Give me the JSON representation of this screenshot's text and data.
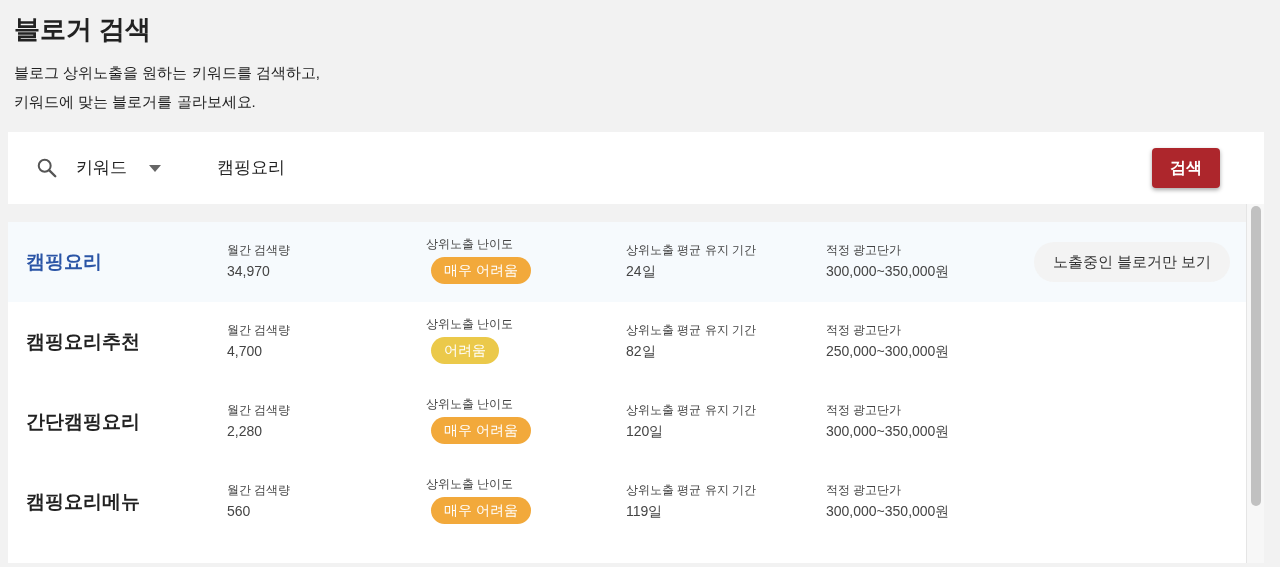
{
  "header": {
    "title": "블로거 검색",
    "description_lines": [
      "블로그 상위노출을 원하는 키워드를 검색하고,",
      "키워드에 맞는 블로거를 골라보세요."
    ]
  },
  "search": {
    "mode": "키워드",
    "value": "캠핑요리",
    "button": "검색"
  },
  "results": [
    {
      "keyword": "캠핑요리",
      "selected": true,
      "volume_label": "월간 검색량",
      "volume": "34,970",
      "difficulty_label": "상위노출 난이도",
      "difficulty": "매우 어려움",
      "color": "#f2a93b",
      "duration_label": "상위노출 평균 유지 기간",
      "duration": "24일",
      "price_label": "적정 광고단가",
      "price": "300,000~350,000원",
      "action": "노출중인 블로거만 보기"
    },
    {
      "keyword": "캠핑요리추천",
      "selected": false,
      "volume_label": "월간 검색량",
      "volume": "4,700",
      "difficulty_label": "상위노출 난이도",
      "difficulty": "어려움",
      "color": "#ebc94a",
      "duration_label": "상위노출 평균 유지 기간",
      "duration": "82일",
      "price_label": "적정 광고단가",
      "price": "250,000~300,000원"
    },
    {
      "keyword": "간단캠핑요리",
      "selected": false,
      "volume_label": "월간 검색량",
      "volume": "2,280",
      "difficulty_label": "상위노출 난이도",
      "difficulty": "매우 어려움",
      "color": "#f2a93b",
      "duration_label": "상위노출 평균 유지 기간",
      "duration": "120일",
      "price_label": "적정 광고단가",
      "price": "300,000~350,000원"
    },
    {
      "keyword": "캠핑요리메뉴",
      "selected": false,
      "volume_label": "월간 검색량",
      "volume": "560",
      "difficulty_label": "상위노출 난이도",
      "difficulty": "매우 어려움",
      "color": "#f2a93b",
      "duration_label": "상위노출 평균 유지 기간",
      "duration": "119일",
      "price_label": "적정 광고단가",
      "price": "300,000~350,000원"
    }
  ]
}
